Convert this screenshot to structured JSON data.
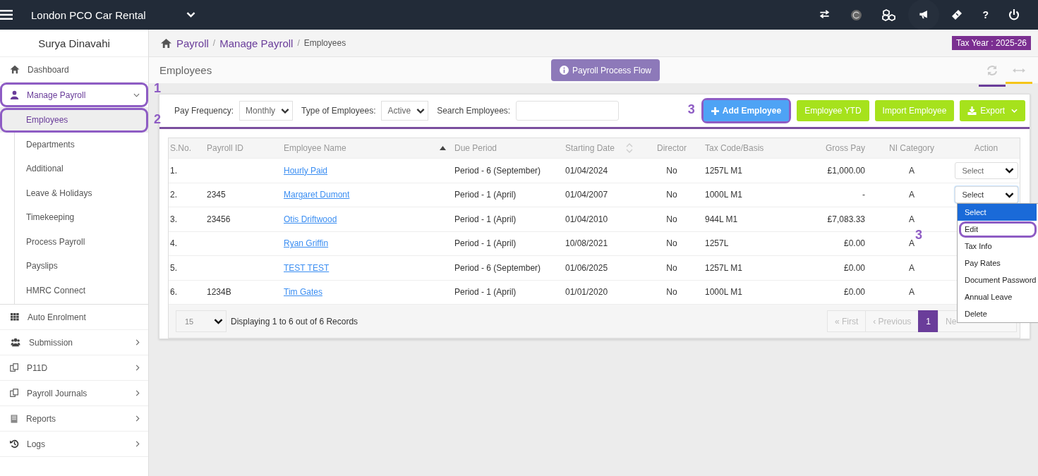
{
  "topbar": {
    "company": "London PCO Car Rental",
    "help": "?"
  },
  "sidebar": {
    "user": "Surya Dinavahi",
    "items": [
      {
        "label": "Dashboard",
        "selected": false
      },
      {
        "label": "Manage Payroll",
        "selected": true,
        "expanded": true,
        "callout": "1",
        "children": [
          {
            "label": "Employees",
            "selected": true,
            "callout": "2"
          },
          {
            "label": "Departments",
            "selected": false
          },
          {
            "label": "Additional",
            "selected": false
          },
          {
            "label": "Leave & Holidays",
            "selected": false
          },
          {
            "label": "Timekeeping",
            "selected": false
          },
          {
            "label": "Process Payroll",
            "selected": false
          },
          {
            "label": "Payslips",
            "selected": false
          },
          {
            "label": "HMRC Connect",
            "selected": false
          }
        ]
      },
      {
        "label": "Auto Enrolment",
        "selected": false
      },
      {
        "label": "Submission",
        "selected": false,
        "expanded": false
      },
      {
        "label": "P11D",
        "selected": false,
        "expanded": false
      },
      {
        "label": "Payroll Journals",
        "selected": false,
        "expanded": false
      },
      {
        "label": "Reports",
        "selected": false,
        "expanded": false
      },
      {
        "label": "Logs",
        "selected": false,
        "expanded": false
      }
    ]
  },
  "breadcrumb": [
    {
      "label": "Payroll",
      "kind": "link"
    },
    {
      "label": "/",
      "kind": "separator"
    },
    {
      "label": "Manage Payroll",
      "kind": "link"
    },
    {
      "label": "/",
      "kind": "separator"
    },
    {
      "label": "Employees",
      "kind": "current"
    }
  ],
  "tax_year": "Tax Year : 2025-26",
  "page_title": "Employees",
  "process_flow_button": "Payroll Process Flow",
  "filters": [
    {
      "label": "Pay Frequency:",
      "kind": "select",
      "value": "Monthly"
    },
    {
      "label": "Type of Employees:",
      "kind": "select",
      "value": "Active"
    },
    {
      "label": "Search Employees:",
      "kind": "text"
    }
  ],
  "actions": [
    {
      "label": "Add Employee",
      "kind": "primary",
      "callout": "3"
    },
    {
      "label": "Employee YTD",
      "kind": "success"
    },
    {
      "label": "Import Employee",
      "kind": "success"
    },
    {
      "label": "Export",
      "kind": "export"
    }
  ],
  "table": {
    "columns": [
      {
        "label": "S.No."
      },
      {
        "label": "Payroll ID"
      },
      {
        "label": "Employee Name",
        "sorted": true
      },
      {
        "label": "Due Period"
      },
      {
        "label": "Starting Date",
        "sortable": true
      },
      {
        "label": "Director"
      },
      {
        "label": "Tax Code/Basis"
      },
      {
        "label": "Gross Pay"
      },
      {
        "label": "NI Category"
      },
      {
        "label": "Action"
      }
    ],
    "rows": [
      {
        "cells": [
          "1.",
          "",
          "Hourly Paid",
          "Period - 6 (September)",
          "01/04/2024",
          "No",
          "1257L M1",
          "£1,000.00",
          "A"
        ],
        "action": {
          "value": "Select",
          "open": false
        }
      },
      {
        "cells": [
          "2.",
          "2345",
          "Margaret Dumont",
          "Period - 1 (April)",
          "01/04/2007",
          "No",
          "1000L M1",
          "-",
          "A"
        ],
        "action": {
          "value": "Select",
          "open": true,
          "options": [
            {
              "label": "Select",
              "selected": true
            },
            {
              "label": "Edit",
              "selected": false,
              "callout": "3"
            },
            {
              "label": "Tax Info",
              "selected": false
            },
            {
              "label": "Pay Rates",
              "selected": false
            },
            {
              "label": "Document Password",
              "selected": false
            },
            {
              "label": "Annual Leave",
              "selected": false
            },
            {
              "label": "Delete",
              "selected": false
            }
          ]
        }
      },
      {
        "cells": [
          "3.",
          "23456",
          "Otis Driftwood",
          "Period - 1 (April)",
          "01/04/2010",
          "No",
          "944L M1",
          "£7,083.33",
          "A"
        ]
      },
      {
        "cells": [
          "4.",
          "",
          "Ryan Griffin",
          "Period - 1 (April)",
          "10/08/2021",
          "No",
          "1257L",
          "£0.00",
          "A"
        ]
      },
      {
        "cells": [
          "5.",
          "",
          "TEST TEST",
          "Period - 6 (September)",
          "01/06/2025",
          "No",
          "1257L M1",
          "£0.00",
          "A"
        ]
      },
      {
        "cells": [
          "6.",
          "1234B",
          "Tim Gates",
          "Period - 1 (April)",
          "01/01/2020",
          "No",
          "1000L M1",
          "£0.00",
          "A"
        ]
      }
    ]
  },
  "pager": {
    "page_size": "15",
    "summary": "Displaying 1 to 6 out of 6 Records",
    "pages": [
      {
        "label": "« First",
        "selected": false
      },
      {
        "label": "‹ Previous",
        "selected": false
      },
      {
        "label": "1",
        "selected": true
      },
      {
        "label": "Ne",
        "selected": false
      }
    ]
  }
}
